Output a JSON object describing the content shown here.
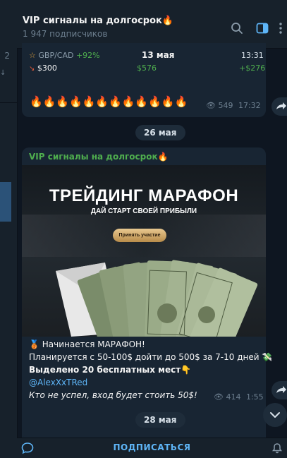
{
  "left_pane": {
    "digit": "2"
  },
  "header": {
    "title": "VIP сигналы на долгосрок🔥",
    "subtitle": "1 947 подписчиков",
    "icons": [
      "search-icon",
      "sidebar-toggle-icon",
      "more-icon"
    ]
  },
  "msg1": {
    "pair": "GBP/CAD",
    "pair_change": "+92%",
    "date": "13 мая",
    "time_top": "13:31",
    "amount": "$300",
    "mid_value": "$576",
    "profit": "+$276",
    "fires": "🔥🔥🔥🔥🔥🔥🔥🔥🔥🔥🔥🔥",
    "views": "549",
    "time": "17:32"
  },
  "date_sep_1": "26 мая",
  "msg2": {
    "sender": "VIP сигналы на долгосрок🔥",
    "promo_title": "ТРЕЙДИНГ МАРАФОН",
    "promo_subtitle": "ДАЙ СТАРТ СВОЕЙ ПРИБЫЛИ",
    "promo_cta": "Принять участие",
    "line1": "🥉 Начинается МАРАФОН!",
    "line2": "Планируется с 50-100$ дойти до 500$ за 7-10 дней 💸",
    "line3": "Выделено 20 бесплатных мест👇",
    "line4": "@AlexXxTRed",
    "line5": "Кто не успел, вход будет стоить 50$!",
    "views": "414",
    "time": "1:55"
  },
  "date_sep_2": "28 мая",
  "bottom": {
    "subscribe_label": "ПОДПИСАТЬСЯ"
  },
  "colors": {
    "accent": "#5eb5f7",
    "green": "#4fae4e",
    "bubble": "#182533",
    "background": "#0e1621"
  }
}
